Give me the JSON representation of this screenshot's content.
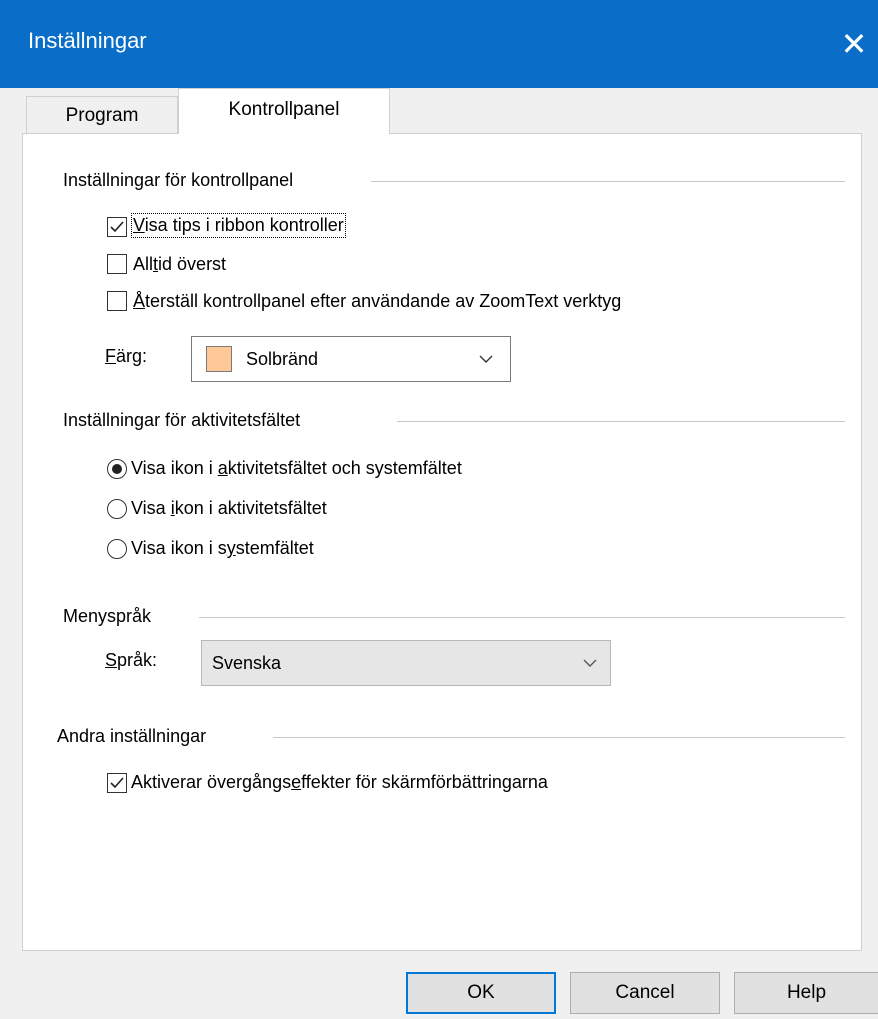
{
  "window": {
    "title": "Inställningar",
    "close_glyph": "✕"
  },
  "tabs": [
    {
      "label": "Program",
      "active": false
    },
    {
      "label": "Kontrollpanel",
      "active": true
    }
  ],
  "groups": {
    "kontrollpanel": {
      "title": "Inställningar för kontrollpanel",
      "options": [
        {
          "label_pre": "",
          "label_u": "V",
          "label_post": "isa tips i ribbon kontroller",
          "checked": true
        },
        {
          "label_pre": "All",
          "label_u": "t",
          "label_post": "id överst",
          "checked": false
        },
        {
          "label_pre": "",
          "label_u": "Å",
          "label_post": "terställ kontrollpanel efter användande av ZoomText verktyg",
          "checked": false
        }
      ],
      "color": {
        "label_u": "F",
        "label_post": "ärg:",
        "value": "Solbränd",
        "swatch_color": "#fec899"
      }
    },
    "aktivitetsfaltet": {
      "title": "Inställningar för aktivitetsfältet",
      "options": [
        {
          "label_pre": "Visa ikon i ",
          "label_u": "a",
          "label_post": "ktivitetsfältet och systemfältet",
          "selected": true
        },
        {
          "label_pre": "Visa ",
          "label_u": "i",
          "label_post": "kon i aktivitetsfältet",
          "selected": false
        },
        {
          "label_pre": "Visa ikon i s",
          "label_u": "y",
          "label_post": "stemfältet",
          "selected": false
        }
      ]
    },
    "menysprak": {
      "title": "Menyspråk",
      "language": {
        "label_u": "S",
        "label_post": "pråk:",
        "value": "Svenska"
      }
    },
    "andra": {
      "title": "Andra inställningar",
      "options": [
        {
          "label_pre": "Aktiverar övergångs",
          "label_u": "e",
          "label_post": "ffekter för skärmförbättringarna",
          "checked": true
        }
      ]
    }
  },
  "buttons": {
    "ok": "OK",
    "cancel": "Cancel",
    "help": "Help"
  },
  "colors": {
    "titlebar": "#0a6ec9",
    "focus_border": "#0078d7"
  }
}
